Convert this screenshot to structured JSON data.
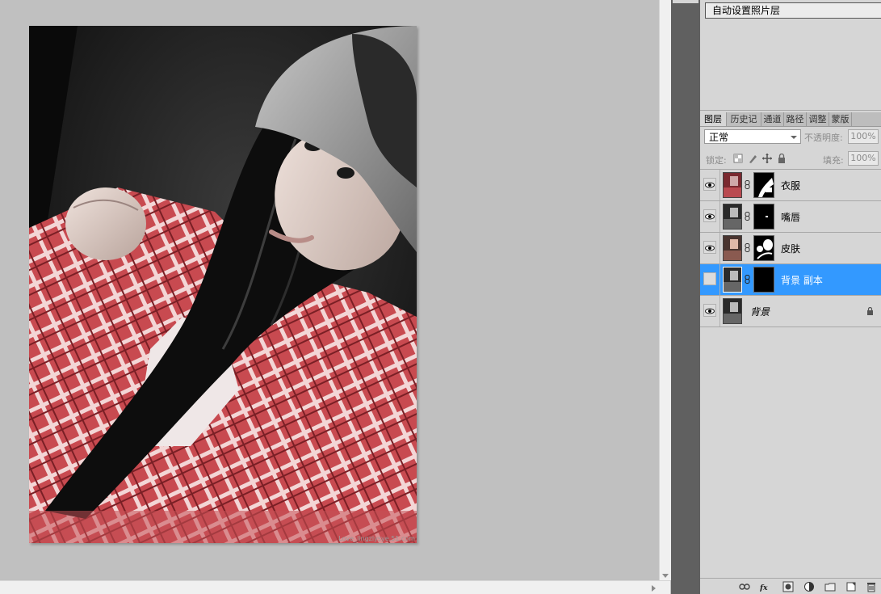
{
  "document": {
    "watermark": "Love_lingzlysye.51.com"
  },
  "actions_panel": {
    "item": "自动设置照片层"
  },
  "tabs": [
    "图层",
    "历史记",
    "通道",
    "路径",
    "调整",
    "蒙版"
  ],
  "layers_panel": {
    "blend_mode": "正常",
    "opacity_label": "不透明度:",
    "opacity_value": "100%",
    "lock_label": "锁定:",
    "fill_label": "填充:",
    "fill_value": "100%"
  },
  "layers": [
    {
      "name": "衣服",
      "visible": true,
      "selected": false,
      "has_mask": true,
      "locked": false
    },
    {
      "name": "嘴唇",
      "visible": true,
      "selected": false,
      "has_mask": true,
      "locked": false
    },
    {
      "name": "皮肤",
      "visible": true,
      "selected": false,
      "has_mask": true,
      "locked": false
    },
    {
      "name": "背景 副本",
      "visible": false,
      "selected": true,
      "has_mask": true,
      "locked": false
    },
    {
      "name": "背景",
      "visible": true,
      "selected": false,
      "has_mask": false,
      "locked": true
    }
  ],
  "colors": {
    "selection": "#3399ff",
    "panel": "#d6d6d6",
    "canvas_bg": "#c0c0c0",
    "shirt_red": "#c0444a"
  }
}
